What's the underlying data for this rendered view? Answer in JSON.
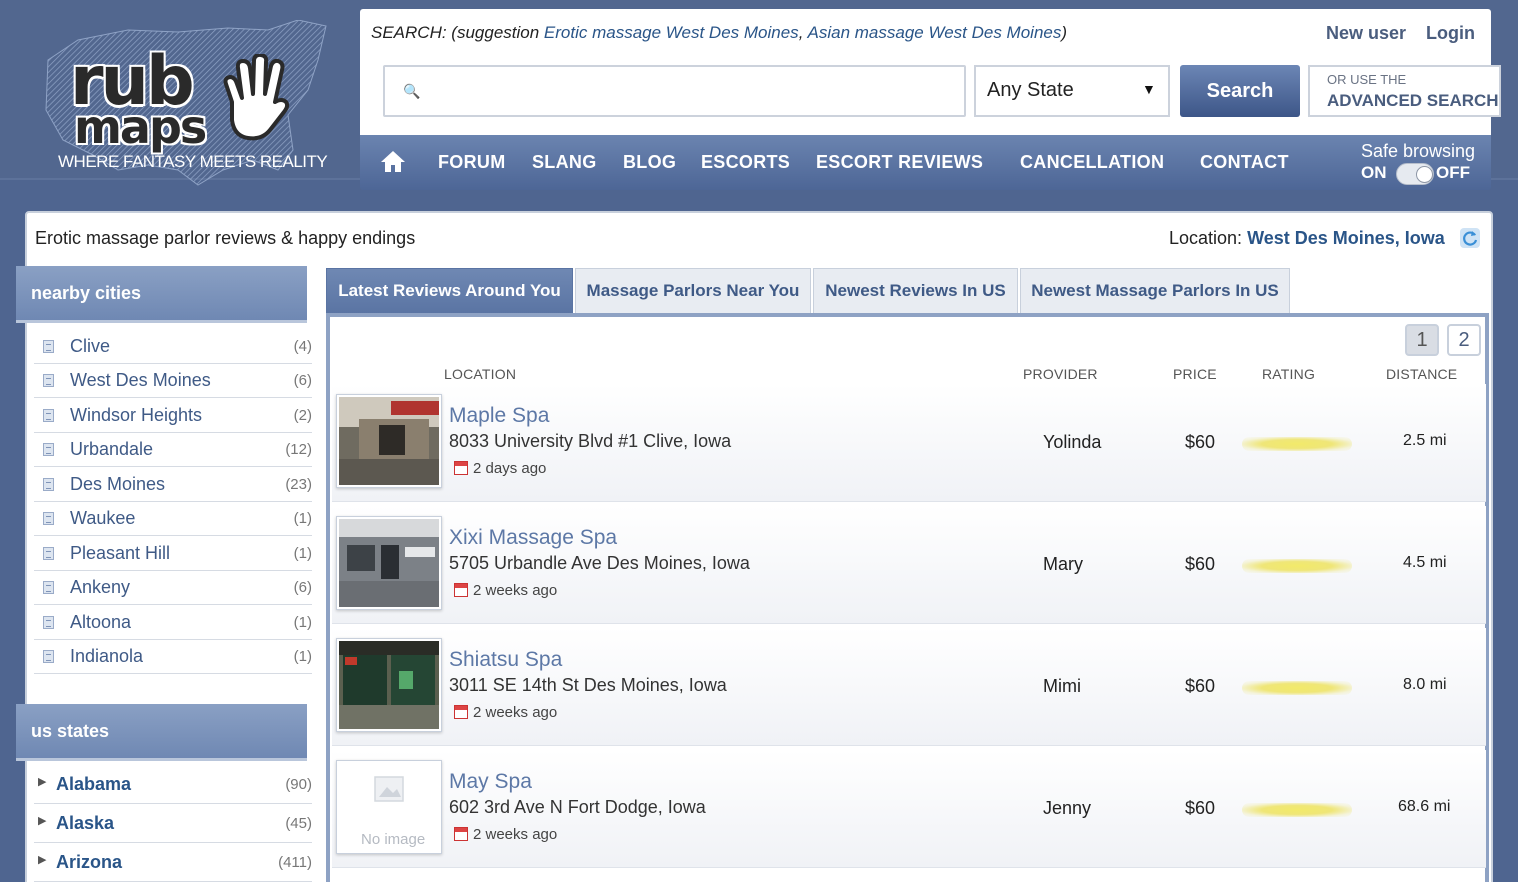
{
  "logo": {
    "rub": "rub",
    "maps": "maps",
    "tagline": "WHERE FANTASY MEETS REALITY"
  },
  "header": {
    "suggest_prefix": "SEARCH: (suggestion ",
    "suggest_1": "Erotic massage West Des Moines",
    "suggest_sep": ", ",
    "suggest_2": "Asian massage West Des Moines",
    "suggest_suffix": ")",
    "new_user": "New user",
    "login": "Login",
    "search_value": "",
    "state_selected": "Any State",
    "search_button": "Search",
    "adv_line1": "OR USE THE",
    "adv_line2": "ADVANCED SEARCH"
  },
  "nav": {
    "items": [
      "FORUM",
      "SLANG",
      "BLOG",
      "ESCORTS",
      "ESCORT REVIEWS",
      "CANCELLATION",
      "CONTACT"
    ],
    "safe_label": "Safe browsing",
    "safe_on": "ON",
    "safe_off": "OFF"
  },
  "main": {
    "intro": "Erotic massage parlor reviews & happy endings",
    "location_label": "Location: ",
    "location_value": "West Des Moines, Iowa"
  },
  "sidebar": {
    "nearby_title": "nearby cities",
    "cities": [
      {
        "name": "Clive",
        "count": "(4)"
      },
      {
        "name": "West Des Moines",
        "count": "(6)"
      },
      {
        "name": "Windsor Heights",
        "count": "(2)"
      },
      {
        "name": "Urbandale",
        "count": "(12)"
      },
      {
        "name": "Des Moines",
        "count": "(23)"
      },
      {
        "name": "Waukee",
        "count": "(1)"
      },
      {
        "name": "Pleasant Hill",
        "count": "(1)"
      },
      {
        "name": "Ankeny",
        "count": "(6)"
      },
      {
        "name": "Altoona",
        "count": "(1)"
      },
      {
        "name": "Indianola",
        "count": "(1)"
      }
    ],
    "states_title": "us states",
    "states": [
      {
        "name": "Alabama",
        "count": "(90)"
      },
      {
        "name": "Alaska",
        "count": "(45)"
      },
      {
        "name": "Arizona",
        "count": "(411)"
      }
    ]
  },
  "tabs": [
    {
      "label": "Latest Reviews Around You",
      "active": true
    },
    {
      "label": "Massage Parlors Near You",
      "active": false
    },
    {
      "label": "Newest Reviews In US",
      "active": false
    },
    {
      "label": "Newest Massage Parlors In US",
      "active": false
    }
  ],
  "pagination": [
    "1",
    "2"
  ],
  "columns": {
    "location": "LOCATION",
    "provider": "PROVIDER",
    "price": "PRICE",
    "rating": "RATING",
    "distance": "DISTANCE"
  },
  "reviews": [
    {
      "name": "Maple Spa",
      "address": "8033 University Blvd #1 Clive, Iowa",
      "ago": "2 days ago",
      "provider": "Yolinda",
      "price": "$60",
      "distance": "2.5 mi"
    },
    {
      "name": "Xixi Massage Spa",
      "address": "5705 Urbandle Ave Des Moines, Iowa",
      "ago": "2 weeks ago",
      "provider": "Mary",
      "price": "$60",
      "distance": "4.5 mi"
    },
    {
      "name": "Shiatsu Spa",
      "address": "3011 SE 14th St Des Moines, Iowa",
      "ago": "2 weeks ago",
      "provider": "Mimi",
      "price": "$60",
      "distance": "8.0 mi"
    },
    {
      "name": "May Spa",
      "address": "602 3rd Ave N Fort Dodge, Iowa",
      "ago": "2 weeks ago",
      "provider": "Jenny",
      "price": "$60",
      "distance": "68.6 mi",
      "no_image_label": "No image"
    }
  ],
  "colors": {
    "nav_bg": "#5a74a3",
    "link": "#2a5588",
    "page_bg": "#4f6590"
  }
}
